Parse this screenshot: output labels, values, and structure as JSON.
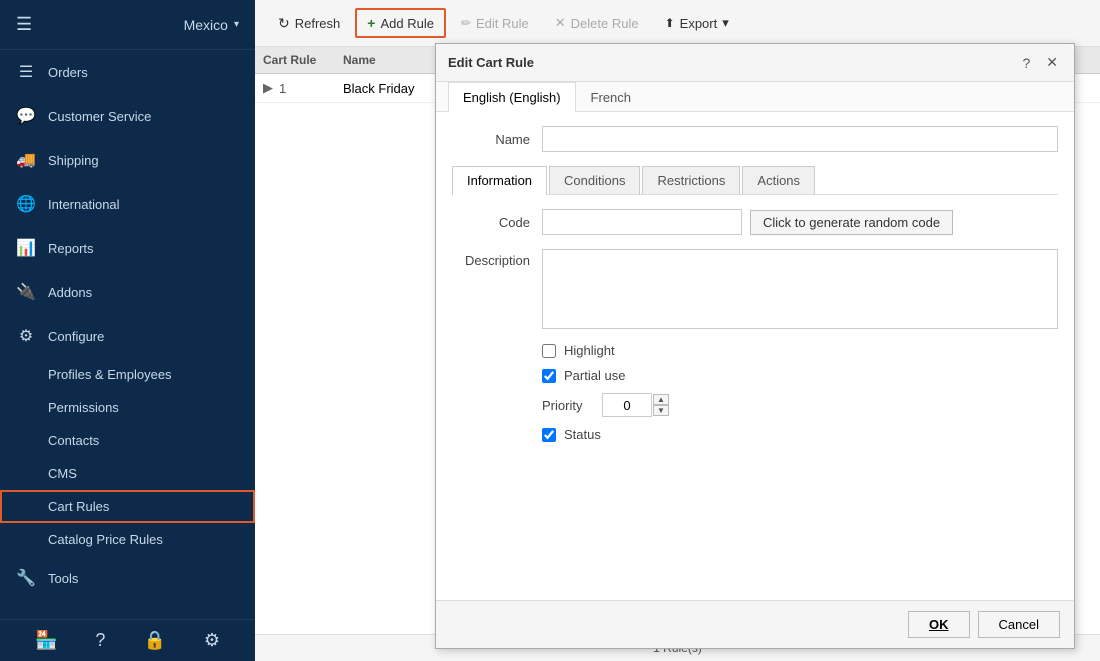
{
  "sidebar": {
    "store": "Mexico",
    "chevron": "▾",
    "nav_items": [
      {
        "id": "orders",
        "icon": "☰",
        "label": "Orders"
      },
      {
        "id": "customer-service",
        "icon": "💬",
        "label": "Customer Service"
      },
      {
        "id": "shipping",
        "icon": "🚚",
        "label": "Shipping"
      },
      {
        "id": "international",
        "icon": "🌐",
        "label": "International"
      },
      {
        "id": "reports",
        "icon": "📊",
        "label": "Reports"
      },
      {
        "id": "addons",
        "icon": "🔌",
        "label": "Addons"
      },
      {
        "id": "configure",
        "icon": "⚙",
        "label": "Configure"
      }
    ],
    "sub_items": [
      {
        "id": "profiles-employees",
        "label": "Profiles & Employees"
      },
      {
        "id": "permissions",
        "label": "Permissions"
      },
      {
        "id": "contacts",
        "label": "Contacts"
      },
      {
        "id": "cms",
        "label": "CMS"
      },
      {
        "id": "cart-rules",
        "label": "Cart Rules",
        "active": true
      },
      {
        "id": "catalog-price-rules",
        "label": "Catalog Price Rules"
      }
    ],
    "footer_icons": [
      {
        "id": "store-icon",
        "icon": "🏪"
      },
      {
        "id": "help-icon",
        "icon": "?"
      },
      {
        "id": "lock-icon",
        "icon": "🔒"
      },
      {
        "id": "settings-icon",
        "icon": "⚙"
      }
    ]
  },
  "toolbar": {
    "refresh_label": "Refresh",
    "add_rule_label": "Add Rule",
    "edit_rule_label": "Edit Rule",
    "delete_rule_label": "Delete Rule",
    "export_label": "Export"
  },
  "table": {
    "col_cart_rule": "Cart Rule",
    "col_name": "Name",
    "rows": [
      {
        "id": 1,
        "name": "Black Friday"
      }
    ],
    "footer": "1 Rule(s)"
  },
  "edit_panel": {
    "title": "Edit Cart Rule",
    "lang_tabs": [
      {
        "id": "english",
        "label": "English (English)",
        "active": true
      },
      {
        "id": "french",
        "label": "French",
        "active": false
      }
    ],
    "name_label": "Name",
    "name_value": "",
    "name_placeholder": "",
    "section_tabs": [
      {
        "id": "information",
        "label": "Information",
        "active": true
      },
      {
        "id": "conditions",
        "label": "Conditions"
      },
      {
        "id": "restrictions",
        "label": "Restrictions"
      },
      {
        "id": "actions",
        "label": "Actions"
      }
    ],
    "code_label": "Code",
    "code_value": "",
    "generate_btn_label": "Click to generate random code",
    "description_label": "Description",
    "description_value": "",
    "highlight_label": "Highlight",
    "highlight_checked": false,
    "partial_use_label": "Partial use",
    "partial_use_checked": true,
    "priority_label": "Priority",
    "priority_value": "0",
    "status_label": "Status",
    "status_checked": true,
    "ok_label": "OK",
    "cancel_label": "Cancel"
  }
}
